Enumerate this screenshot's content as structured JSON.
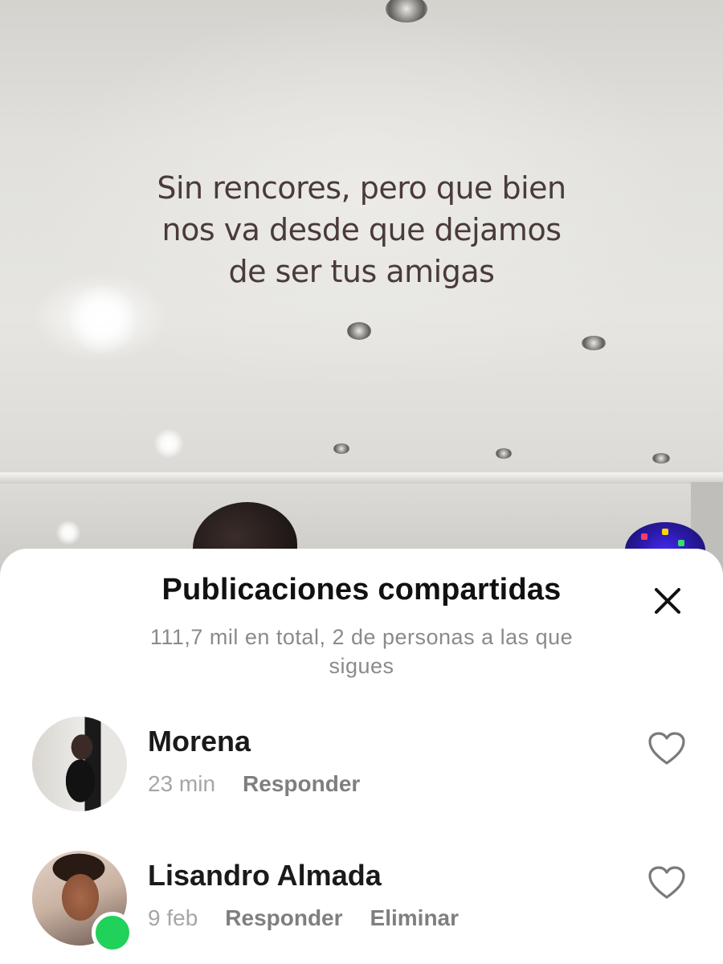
{
  "video": {
    "overlay_text_lines": [
      "Sin rencores, pero que bien",
      "nos va desde que dejamos",
      "de ser tus amigas"
    ]
  },
  "sheet": {
    "title": "Publicaciones compartidas",
    "subtitle": "111,7 mil en total, 2 de personas a las que sigues",
    "close_icon": "close-icon",
    "items": [
      {
        "name": "Morena",
        "time": "23 min",
        "reply_label": "Responder",
        "online": false,
        "like_icon": "heart-outline-icon"
      },
      {
        "name": "Lisandro Almada",
        "time": "9 feb",
        "reply_label": "Responder",
        "delete_label": "Eliminar",
        "online": true,
        "like_icon": "heart-outline-icon"
      }
    ]
  },
  "colors": {
    "online": "#20d15a",
    "overlay_text": "#4a3b38",
    "subtitle": "#8a8a8a"
  }
}
